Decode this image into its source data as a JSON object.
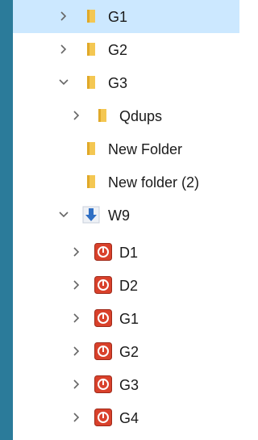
{
  "tree": {
    "items": [
      {
        "label": "G1",
        "expanded": false,
        "icon": "folder-icon",
        "selected": true
      },
      {
        "label": "G2",
        "expanded": false,
        "icon": "folder-icon"
      },
      {
        "label": "G3",
        "expanded": true,
        "icon": "folder-icon"
      },
      {
        "label": "Qdups",
        "expanded": false,
        "icon": "folder-icon"
      },
      {
        "label": "New Folder",
        "icon": "folder-icon"
      },
      {
        "label": "New folder (2)",
        "icon": "folder-icon"
      },
      {
        "label": "W9",
        "expanded": true,
        "icon": "download-arrow-icon"
      },
      {
        "label": "D1",
        "expanded": false,
        "icon": "power-error-icon"
      },
      {
        "label": "D2",
        "expanded": false,
        "icon": "power-error-icon"
      },
      {
        "label": "G1",
        "expanded": false,
        "icon": "power-error-icon"
      },
      {
        "label": "G2",
        "expanded": false,
        "icon": "power-error-icon"
      },
      {
        "label": "G3",
        "expanded": false,
        "icon": "power-error-icon"
      },
      {
        "label": "G4",
        "expanded": false,
        "icon": "power-error-icon"
      }
    ]
  },
  "colors": {
    "selection": "#cce8ff",
    "left_strip": "#2b7b9a",
    "folder": "#f4c752",
    "error_red": "#d9412b",
    "download_blue": "#2f6fc4"
  }
}
